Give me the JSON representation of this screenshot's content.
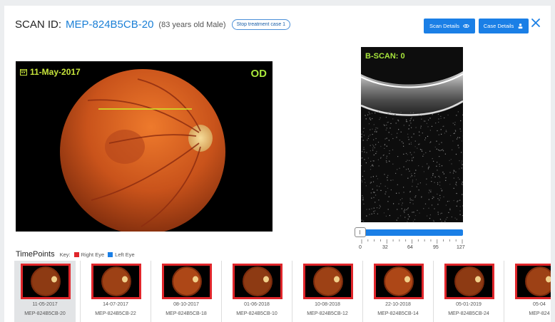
{
  "header": {
    "scan_label": "SCAN ID:",
    "scan_id": "MEP-824B5CB-20",
    "patient_info": "(83 years old Male)",
    "tag": "Stop treatment case 1"
  },
  "buttons": {
    "scan_details": "Scan Details",
    "case_details": "Case Details",
    "close_icon": "close-icon"
  },
  "fundus": {
    "date": "11-May-2017",
    "eye": "OD",
    "calendar_icon": "calendar-icon"
  },
  "bscan": {
    "label": "B-SCAN: 0",
    "slider_value": 0,
    "slider_max": 127,
    "tick_labels": [
      "0",
      "32",
      "64",
      "95",
      "127"
    ]
  },
  "timepoints": {
    "title": "TimePoints",
    "key_label": "Key:",
    "right_eye": "Right Eye",
    "left_eye": "Left Eye",
    "right_eye_color": "#e0262b",
    "left_eye_color": "#1a7fe6",
    "items": [
      {
        "date": "11-05-2017",
        "id": "MEP-824B5CB-20"
      },
      {
        "date": "14-07-2017",
        "id": "MEP-824B5CB-22"
      },
      {
        "date": "08-10-2017",
        "id": "MEP-824B5CB-18"
      },
      {
        "date": "01-06-2018",
        "id": "MEP-824B5CB-10"
      },
      {
        "date": "10-08-2018",
        "id": "MEP-824B5CB-12"
      },
      {
        "date": "22-10-2018",
        "id": "MEP-824B5CB-14"
      },
      {
        "date": "05-01-2019",
        "id": "MEP-824B5CB-24"
      },
      {
        "date": "05-04",
        "id": "MEP-824"
      }
    ]
  }
}
